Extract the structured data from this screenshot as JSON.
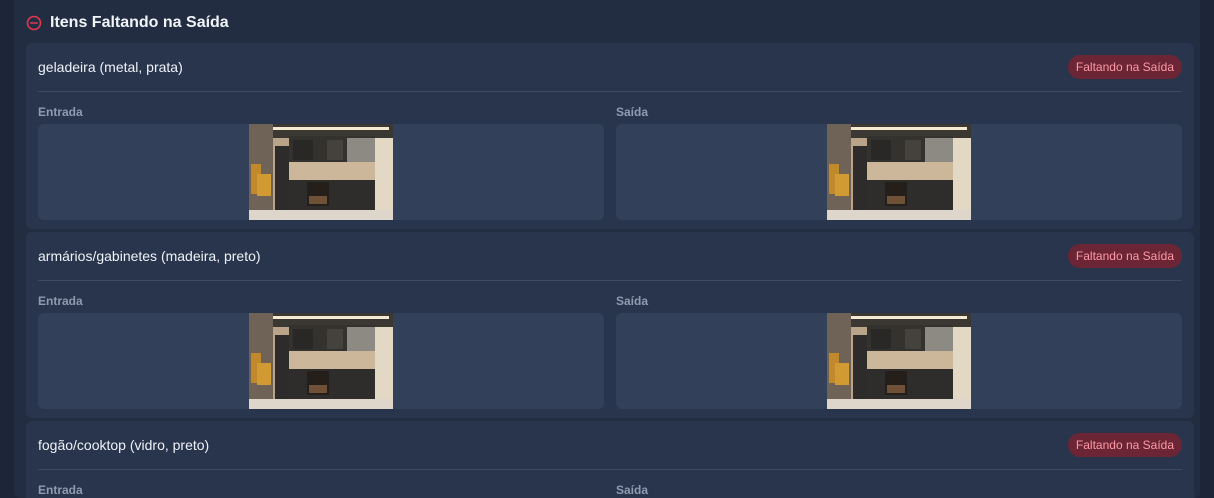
{
  "section": {
    "title": "Itens Faltando na Saída",
    "icon": "minus-circle-icon",
    "accent_color": "#e2384d"
  },
  "items": [
    {
      "name": "geladeira (metal, prata)",
      "status": "Faltando na Saída",
      "entry_label": "Entrada",
      "exit_label": "Saída",
      "entry_photo": "kitchen-photo",
      "exit_photo": "kitchen-photo"
    },
    {
      "name": "armários/gabinetes (madeira, preto)",
      "status": "Faltando na Saída",
      "entry_label": "Entrada",
      "exit_label": "Saída",
      "entry_photo": "kitchen-photo",
      "exit_photo": "kitchen-photo"
    },
    {
      "name": "fogão/cooktop (vidro, preto)",
      "status": "Faltando na Saída",
      "entry_label": "Entrada",
      "exit_label": "Saída",
      "entry_photo": "kitchen-photo",
      "exit_photo": "kitchen-photo"
    }
  ]
}
